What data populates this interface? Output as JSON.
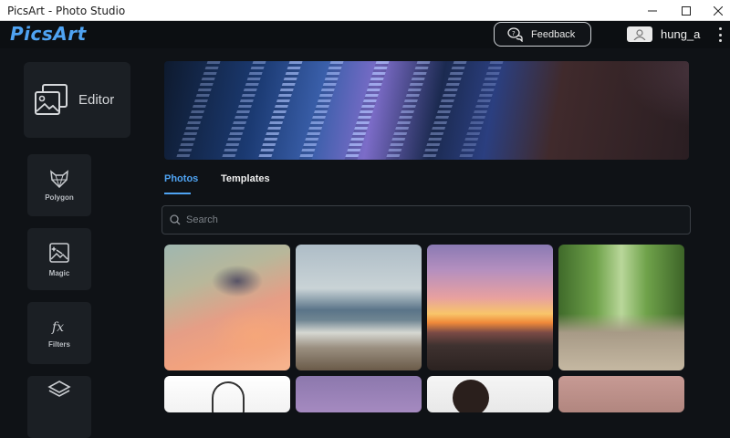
{
  "window": {
    "title": "PicsArt - Photo Studio"
  },
  "header": {
    "logo": "PicsArt",
    "feedback_label": "Feedback",
    "username": "hung_a",
    "accent_color": "#4fa3f2"
  },
  "sidebar": {
    "editor_label": "Editor",
    "tools": [
      {
        "label": "Polygon",
        "icon": "polygon-fox-icon"
      },
      {
        "label": "Magic",
        "icon": "magic-image-icon"
      },
      {
        "label": "Filters",
        "icon": "fx-icon"
      },
      {
        "label": "",
        "icon": "layers-icon"
      }
    ]
  },
  "main": {
    "tabs": [
      {
        "label": "Photos",
        "active": true
      },
      {
        "label": "Templates",
        "active": false
      }
    ],
    "search": {
      "placeholder": "Search"
    },
    "photos": [
      {
        "subject": "pastel sunset sky"
      },
      {
        "subject": "beach rocks"
      },
      {
        "subject": "sunset over sea"
      },
      {
        "subject": "wooden forest walkway"
      },
      {
        "subject": "pencil sketch portrait"
      },
      {
        "subject": "purple sky"
      },
      {
        "subject": "portrait"
      },
      {
        "subject": "pink texture"
      }
    ]
  }
}
